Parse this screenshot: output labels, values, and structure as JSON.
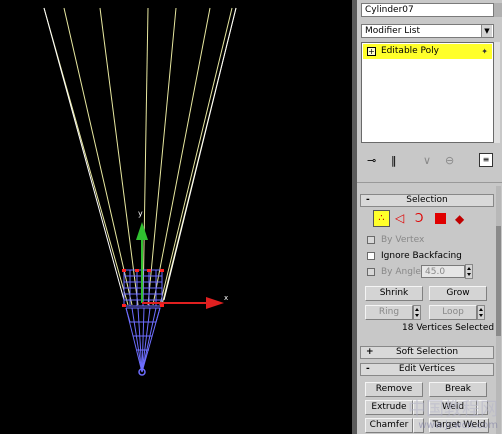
{
  "object_name": "Cylinder07",
  "modifier_list_label": "Modifier List",
  "modifier_stack": {
    "items": [
      {
        "label": "Editable Poly",
        "selected": true
      }
    ]
  },
  "stack_toolbar_icons": [
    "pin-stack-icon",
    "show-end-result-icon",
    "make-unique-icon",
    "remove-modifier-icon",
    "configure-modifier-sets-icon"
  ],
  "selection_rollout": {
    "title": "Selection",
    "toggle": "-",
    "subobject_icons": [
      "vertex-icon",
      "edge-icon",
      "border-icon",
      "polygon-icon",
      "element-icon"
    ],
    "by_vertex": {
      "label": "By Vertex",
      "checked": false,
      "enabled": false
    },
    "ignore_backfacing": {
      "label": "Ignore Backfacing",
      "checked": false
    },
    "by_angle": {
      "label": "By Angle:",
      "value": "45.0",
      "enabled": false
    },
    "shrink_label": "Shrink",
    "grow_label": "Grow",
    "ring_label": "Ring",
    "loop_label": "Loop",
    "status": "18 Vertices Selected"
  },
  "soft_selection_rollout": {
    "title": "Soft Selection",
    "toggle": "+"
  },
  "edit_vertices_rollout": {
    "title": "Edit Vertices",
    "toggle": "-",
    "remove_label": "Remove",
    "break_label": "Break",
    "extrude_label": "Extrude",
    "weld_label": "Weld",
    "chamfer_label": "Chamfer",
    "target_weld_label": "Target Weld"
  },
  "viewport": {
    "axis_y_label": "y",
    "axis_x_label": "x"
  },
  "watermark": {
    "line1": "中国教程网",
    "line2": "www.jcwcn.com"
  },
  "colors": {
    "accent_yellow": "#ffff2a",
    "vertex_red": "#ff2020",
    "wire_yellow": "#e8e8a0",
    "mesh_blue": "#6e6eff"
  }
}
